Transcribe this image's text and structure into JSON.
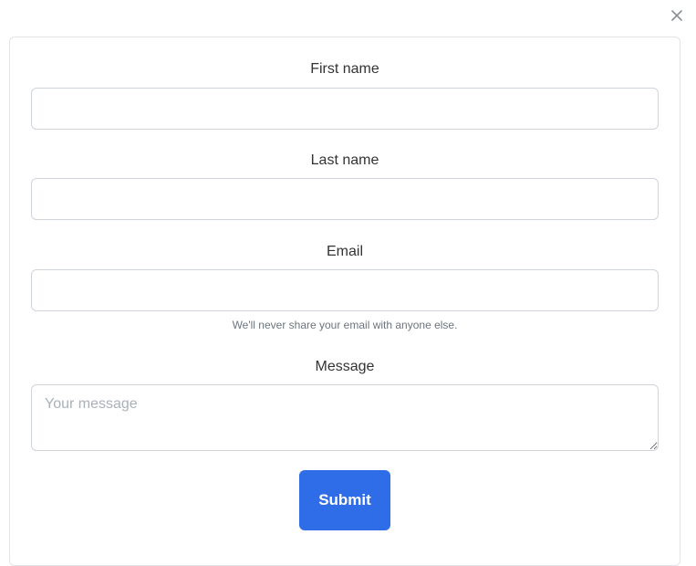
{
  "dialog": {
    "close_icon": "close-icon"
  },
  "form": {
    "first_name": {
      "label": "First name",
      "value": "",
      "placeholder": ""
    },
    "last_name": {
      "label": "Last name",
      "value": "",
      "placeholder": ""
    },
    "email": {
      "label": "Email",
      "value": "",
      "placeholder": "",
      "help_text": "We'll never share your email with anyone else."
    },
    "message": {
      "label": "Message",
      "value": "",
      "placeholder": "Your message"
    },
    "submit_label": "Submit"
  },
  "colors": {
    "accent": "#2f6de8",
    "border": "#cfd4da",
    "help_text": "#6c757d"
  }
}
